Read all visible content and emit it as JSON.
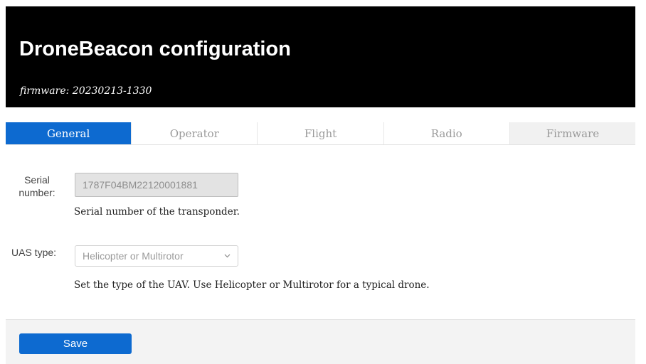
{
  "header": {
    "title": "DroneBeacon configuration",
    "subtitle": "firmware: 20230213-1330"
  },
  "tabs": [
    {
      "label": "General",
      "active": true
    },
    {
      "label": "Operator",
      "active": false
    },
    {
      "label": "Flight",
      "active": false
    },
    {
      "label": "Radio",
      "active": false
    },
    {
      "label": "Firmware",
      "active": false
    }
  ],
  "form": {
    "serial": {
      "label": "Serial number:",
      "value": "1787F04BM22120001881",
      "help": "Serial number of the transponder."
    },
    "uas_type": {
      "label": "UAS type:",
      "selected": "Helicopter or Multirotor",
      "help": "Set the type of the UAV. Use Helicopter or Multirotor for a typical drone."
    }
  },
  "footer": {
    "save_label": "Save"
  },
  "colors": {
    "header_bg": "#000000",
    "accent": "#0d6ad0"
  }
}
